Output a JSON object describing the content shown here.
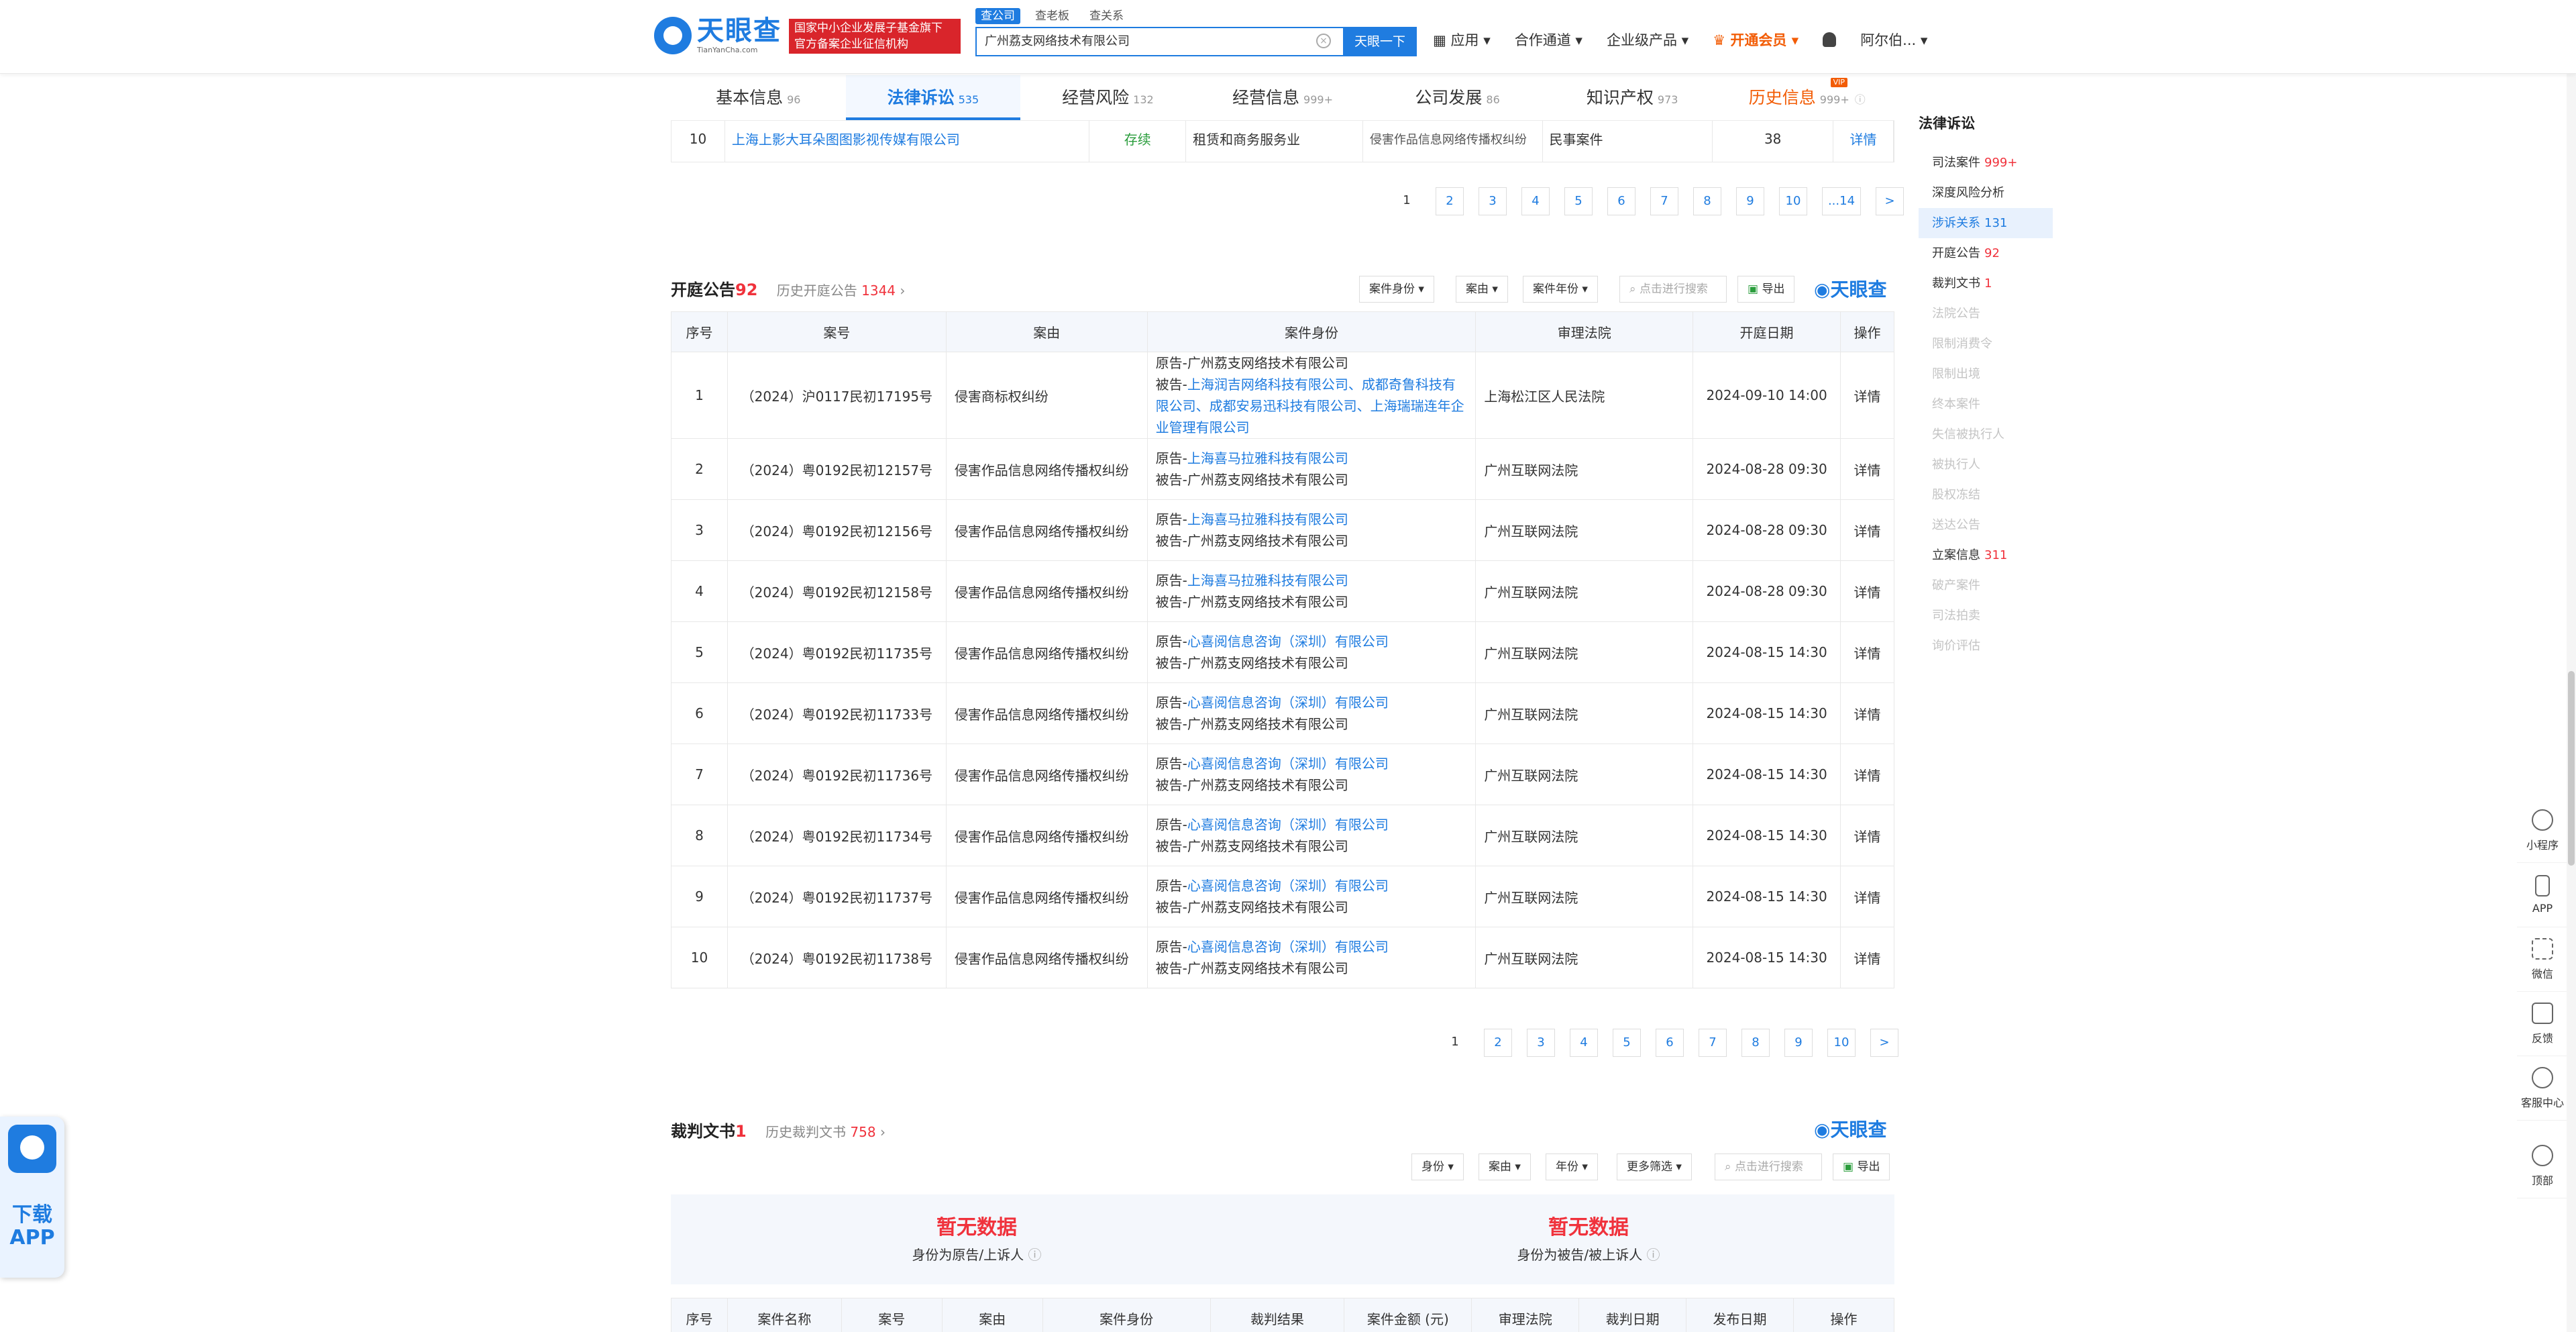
{
  "header": {
    "brand_cn": "天眼查",
    "brand_en": "TianYanCha.com",
    "gov_line1": "国家中小企业发展子基金旗下",
    "gov_line2": "官方备案企业征信机构",
    "search_tabs": [
      "查公司",
      "查老板",
      "查关系"
    ],
    "search_value": "广州荔支网络技术有限公司",
    "search_button": "天眼一下",
    "nav": [
      "应用",
      "合作通道",
      "企业级产品",
      "开通会员",
      "阿尔伯..."
    ]
  },
  "subtabs": [
    {
      "label": "基本信息",
      "count": "96"
    },
    {
      "label": "法律诉讼",
      "count": "535"
    },
    {
      "label": "经营风险",
      "count": "132"
    },
    {
      "label": "经营信息",
      "count": "999+"
    },
    {
      "label": "公司发展",
      "count": "86"
    },
    {
      "label": "知识产权",
      "count": "973"
    },
    {
      "label": "历史信息",
      "count": "999+",
      "flag": "VIP"
    }
  ],
  "prev_row": {
    "index": "10",
    "company": "上海上影大耳朵图图影视传媒有限公司",
    "status": "存续",
    "industry": "租赁和商务服务业",
    "cause": "侵害作品信息网络传播权纠纷",
    "type": "民事案件",
    "num": "38",
    "action": "详情"
  },
  "pager1": [
    "1",
    "2",
    "3",
    "4",
    "5",
    "6",
    "7",
    "8",
    "9",
    "10",
    "...14",
    ">"
  ],
  "court_notice": {
    "title": "开庭公告",
    "count": "92",
    "history_label": "历史开庭公告",
    "history_count": "1344",
    "filters": [
      "案件身份",
      "案由",
      "案件年份"
    ],
    "search_placeholder": "点击进行搜索",
    "export": "导出",
    "columns": [
      "序号",
      "案号",
      "案由",
      "案件身份",
      "审理法院",
      "开庭日期",
      "操作"
    ],
    "rows": [
      {
        "idx": "1",
        "case_no": "（2024）沪0117民初17195号",
        "cause": "侵害商标权纠纷",
        "role1": "原告-广州荔支网络技术有限公司",
        "role2_prefix": "被告-",
        "role2": "上海润吉网络科技有限公司、成都奇鲁科技有限公司、成都安易迅科技有限公司、上海瑞瑞连年企业管理有限公司",
        "court": "上海松江区人民法院",
        "date": "2024-09-10 14:00",
        "action": "详情"
      },
      {
        "idx": "2",
        "case_no": "（2024）粤0192民初12157号",
        "cause": "侵害作品信息网络传播权纠纷",
        "role1_prefix": "原告-",
        "role1_link": "上海喜马拉雅科技有限公司",
        "role2": "被告-广州荔支网络技术有限公司",
        "court": "广州互联网法院",
        "date": "2024-08-28 09:30",
        "action": "详情"
      },
      {
        "idx": "3",
        "case_no": "（2024）粤0192民初12156号",
        "cause": "侵害作品信息网络传播权纠纷",
        "role1_prefix": "原告-",
        "role1_link": "上海喜马拉雅科技有限公司",
        "role2": "被告-广州荔支网络技术有限公司",
        "court": "广州互联网法院",
        "date": "2024-08-28 09:30",
        "action": "详情"
      },
      {
        "idx": "4",
        "case_no": "（2024）粤0192民初12158号",
        "cause": "侵害作品信息网络传播权纠纷",
        "role1_prefix": "原告-",
        "role1_link": "上海喜马拉雅科技有限公司",
        "role2": "被告-广州荔支网络技术有限公司",
        "court": "广州互联网法院",
        "date": "2024-08-28 09:30",
        "action": "详情"
      },
      {
        "idx": "5",
        "case_no": "（2024）粤0192民初11735号",
        "cause": "侵害作品信息网络传播权纠纷",
        "role1_prefix": "原告-",
        "role1_link": "心喜阅信息咨询（深圳）有限公司",
        "role2": "被告-广州荔支网络技术有限公司",
        "court": "广州互联网法院",
        "date": "2024-08-15 14:30",
        "action": "详情"
      },
      {
        "idx": "6",
        "case_no": "（2024）粤0192民初11733号",
        "cause": "侵害作品信息网络传播权纠纷",
        "role1_prefix": "原告-",
        "role1_link": "心喜阅信息咨询（深圳）有限公司",
        "role2": "被告-广州荔支网络技术有限公司",
        "court": "广州互联网法院",
        "date": "2024-08-15 14:30",
        "action": "详情"
      },
      {
        "idx": "7",
        "case_no": "（2024）粤0192民初11736号",
        "cause": "侵害作品信息网络传播权纠纷",
        "role1_prefix": "原告-",
        "role1_link": "心喜阅信息咨询（深圳）有限公司",
        "role2": "被告-广州荔支网络技术有限公司",
        "court": "广州互联网法院",
        "date": "2024-08-15 14:30",
        "action": "详情"
      },
      {
        "idx": "8",
        "case_no": "（2024）粤0192民初11734号",
        "cause": "侵害作品信息网络传播权纠纷",
        "role1_prefix": "原告-",
        "role1_link": "心喜阅信息咨询（深圳）有限公司",
        "role2": "被告-广州荔支网络技术有限公司",
        "court": "广州互联网法院",
        "date": "2024-08-15 14:30",
        "action": "详情"
      },
      {
        "idx": "9",
        "case_no": "（2024）粤0192民初11737号",
        "cause": "侵害作品信息网络传播权纠纷",
        "role1_prefix": "原告-",
        "role1_link": "心喜阅信息咨询（深圳）有限公司",
        "role2": "被告-广州荔支网络技术有限公司",
        "court": "广州互联网法院",
        "date": "2024-08-15 14:30",
        "action": "详情"
      },
      {
        "idx": "10",
        "case_no": "（2024）粤0192民初11738号",
        "cause": "侵害作品信息网络传播权纠纷",
        "role1_prefix": "原告-",
        "role1_link": "心喜阅信息咨询（深圳）有限公司",
        "role2": "被告-广州荔支网络技术有限公司",
        "court": "广州互联网法院",
        "date": "2024-08-15 14:30",
        "action": "详情"
      }
    ]
  },
  "pager2": [
    "1",
    "2",
    "3",
    "4",
    "5",
    "6",
    "7",
    "8",
    "9",
    "10",
    ">"
  ],
  "judgment": {
    "title": "裁判文书",
    "count": "1",
    "history_label": "历史裁判文书",
    "history_count": "758",
    "filters": [
      "身份",
      "案由",
      "年份",
      "更多筛选"
    ],
    "search_placeholder": "点击进行搜索",
    "export": "导出",
    "nodata_title": "暂无数据",
    "nodata_plaintiff": "身份为原告/上诉人",
    "nodata_defendant": "身份为被告/被上诉人",
    "columns": [
      "序号",
      "案件名称",
      "案号",
      "案由",
      "案件身份",
      "裁判结果",
      "案件金额 (元)",
      "审理法院",
      "裁判日期",
      "发布日期",
      "操作"
    ]
  },
  "sidebar": {
    "title": "法律诉讼",
    "items": [
      {
        "label": "司法案件",
        "count": "999+"
      },
      {
        "label": "深度风险分析",
        "count": ""
      },
      {
        "label": "涉诉关系",
        "count": "131"
      },
      {
        "label": "开庭公告",
        "count": "92"
      },
      {
        "label": "裁判文书",
        "count": "1"
      },
      {
        "label": "法院公告",
        "count": ""
      },
      {
        "label": "限制消费令",
        "count": ""
      },
      {
        "label": "限制出境",
        "count": ""
      },
      {
        "label": "终本案件",
        "count": ""
      },
      {
        "label": "失信被执行人",
        "count": ""
      },
      {
        "label": "被执行人",
        "count": ""
      },
      {
        "label": "股权冻结",
        "count": ""
      },
      {
        "label": "送达公告",
        "count": ""
      },
      {
        "label": "立案信息",
        "count": "311"
      },
      {
        "label": "破产案件",
        "count": ""
      },
      {
        "label": "司法拍卖",
        "count": ""
      },
      {
        "label": "询价评估",
        "count": ""
      }
    ]
  },
  "float_bar": [
    "小程序",
    "APP",
    "微信",
    "反馈",
    "客服中心",
    "顶部"
  ],
  "app_badge": {
    "line1": "下载",
    "line2": "APP"
  },
  "colors": {
    "primary": "#1f7ce0",
    "accent_red": "#f0323c",
    "vip_orange": "#f25c05"
  }
}
